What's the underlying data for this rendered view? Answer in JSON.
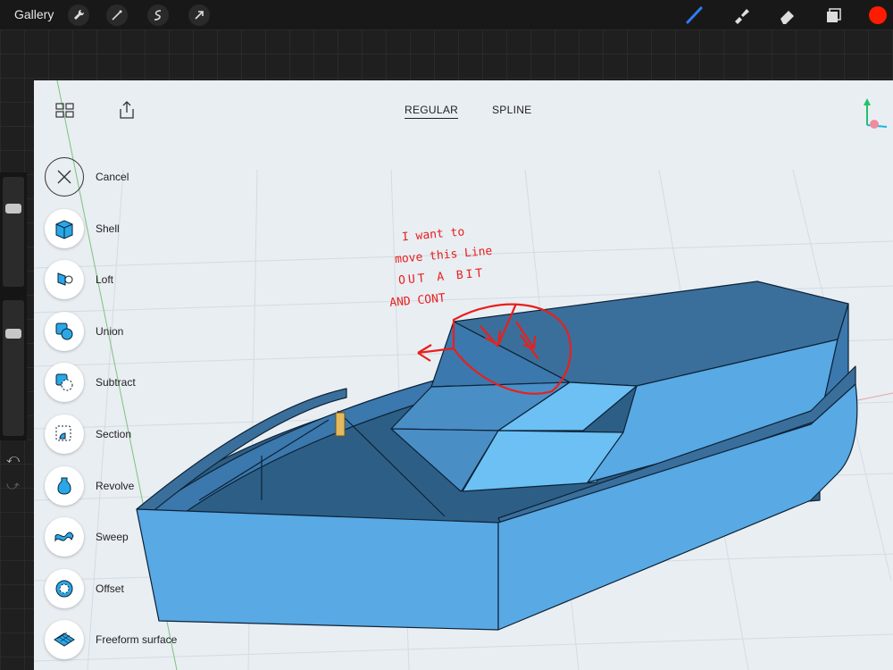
{
  "topbar": {
    "gallery_label": "Gallery",
    "left_tools": [
      "wrench-icon",
      "magic-wand-icon",
      "selection-icon",
      "transform-arrow-icon"
    ],
    "right_tools": [
      "brush-icon",
      "smudge-icon",
      "eraser-icon",
      "layers-icon",
      "color-swatch"
    ],
    "active_color": "#ff1a00",
    "brush_color": "#2f7cf6"
  },
  "canvas": {
    "tabs": [
      {
        "label": "REGULAR",
        "active": true
      },
      {
        "label": "SPLINE",
        "active": false
      }
    ]
  },
  "tools_menu": {
    "items": [
      {
        "label": "Cancel",
        "icon": "close-icon"
      },
      {
        "label": "Shell",
        "icon": "shell-icon"
      },
      {
        "label": "Loft",
        "icon": "loft-icon"
      },
      {
        "label": "Union",
        "icon": "union-icon"
      },
      {
        "label": "Subtract",
        "icon": "subtract-icon"
      },
      {
        "label": "Section",
        "icon": "section-icon"
      },
      {
        "label": "Revolve",
        "icon": "revolve-icon"
      },
      {
        "label": "Sweep",
        "icon": "sweep-icon"
      },
      {
        "label": "Offset",
        "icon": "offset-icon"
      },
      {
        "label": "Freeform surface",
        "icon": "freeform-surface-icon"
      }
    ]
  },
  "annotation": {
    "lines": [
      "I want to",
      "move this Line",
      "OUT A BIT",
      "AND CONT"
    ],
    "color": "#e8201c"
  },
  "colors": {
    "model_blue": "#58a9e4",
    "model_dark": "#3b78ad",
    "model_light": "#6cc0f4"
  }
}
